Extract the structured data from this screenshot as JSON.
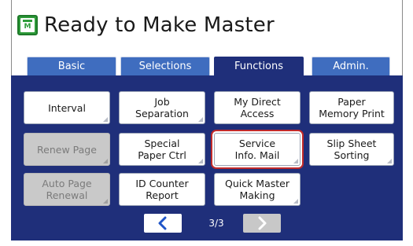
{
  "header": {
    "title": "Ready to Make Master",
    "icon": "master-icon",
    "icon_letter": "M"
  },
  "tabs": [
    {
      "label": "Basic",
      "active": false
    },
    {
      "label": "Selections",
      "active": false
    },
    {
      "label": "Functions",
      "active": true
    },
    {
      "label": "Admin.",
      "active": false
    }
  ],
  "functions": {
    "buttons": [
      {
        "label": "Interval",
        "enabled": true
      },
      {
        "label": "Job\nSeparation",
        "enabled": true
      },
      {
        "label": "My Direct\nAccess",
        "enabled": true
      },
      {
        "label": "Paper\nMemory Print",
        "enabled": true
      },
      {
        "label": "Renew Page",
        "enabled": false
      },
      {
        "label": "Special\nPaper Ctrl",
        "enabled": true
      },
      {
        "label": "Service\nInfo. Mail",
        "enabled": true,
        "highlighted": true
      },
      {
        "label": "Slip Sheet\nSorting",
        "enabled": true
      },
      {
        "label": "Auto Page\nRenewal",
        "enabled": false
      },
      {
        "label": "ID Counter\nReport",
        "enabled": true
      },
      {
        "label": "Quick Master\nMaking",
        "enabled": true
      }
    ]
  },
  "pagination": {
    "page_text": "3/3",
    "prev_icon": "chevron-left-icon",
    "next_icon": "chevron-right-icon",
    "next_enabled": false
  },
  "colors": {
    "panel": "#1f2f7a",
    "tab": "#3f6dbf",
    "highlight": "#c22a2a",
    "icon_green": "#2e9c3a"
  }
}
